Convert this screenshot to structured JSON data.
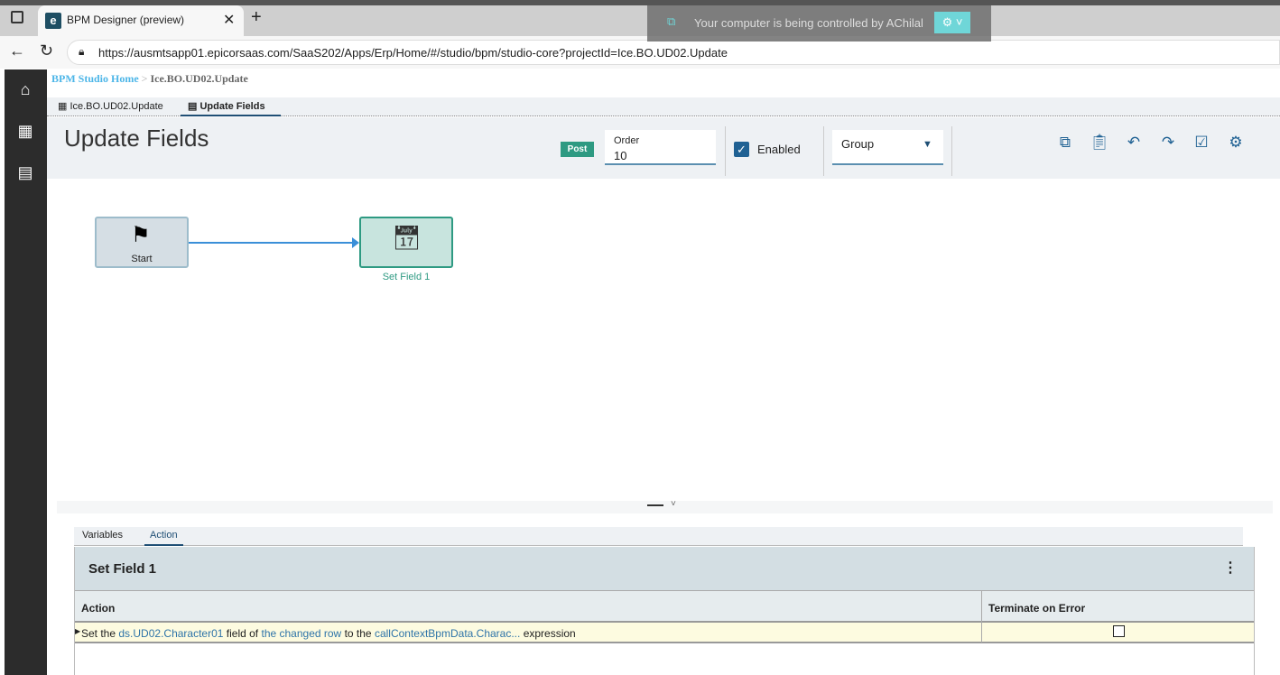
{
  "browser": {
    "tab_title": "BPM Designer (preview)",
    "url": "https://ausmtsapp01.epicorsaas.com/SaaS202/Apps/Erp/Home/#/studio/bpm/studio-core?projectId=Ice.BO.UD02.Update",
    "favicon": "e"
  },
  "banner": {
    "text": "Your computer is being controlled by AChilal"
  },
  "breadcrumb": {
    "home": "BPM Studio Home",
    "sep": ">",
    "current": "Ice.BO.UD02.Update"
  },
  "page_tabs": [
    {
      "label": "Ice.BO.UD02.Update"
    },
    {
      "label": "Update Fields",
      "active": true
    }
  ],
  "header": {
    "title": "Update Fields",
    "badge": "Post",
    "order_label": "Order",
    "order_value": "10",
    "enabled_label": "Enabled",
    "enabled": true,
    "group_label": "Group"
  },
  "canvas": {
    "nodes": [
      {
        "label": "Start"
      },
      {
        "label": "Set Field 1"
      }
    ]
  },
  "bottom": {
    "tabs": [
      {
        "label": "Variables"
      },
      {
        "label": "Action",
        "active": true
      }
    ],
    "panel_title": "Set Field 1",
    "columns": [
      "Action",
      "Terminate on Error"
    ],
    "row": {
      "p1": "Set the",
      "l1": "ds.UD02.Character01",
      "p2": "field of",
      "l2": "the changed row",
      "p3": "to the",
      "l3": "callContextBpmData.Charac...",
      "p4": "expression",
      "terminate": false
    }
  },
  "colors": {
    "accent": "#1f6193",
    "post": "#2e9a82",
    "link": "#2f74a8"
  }
}
